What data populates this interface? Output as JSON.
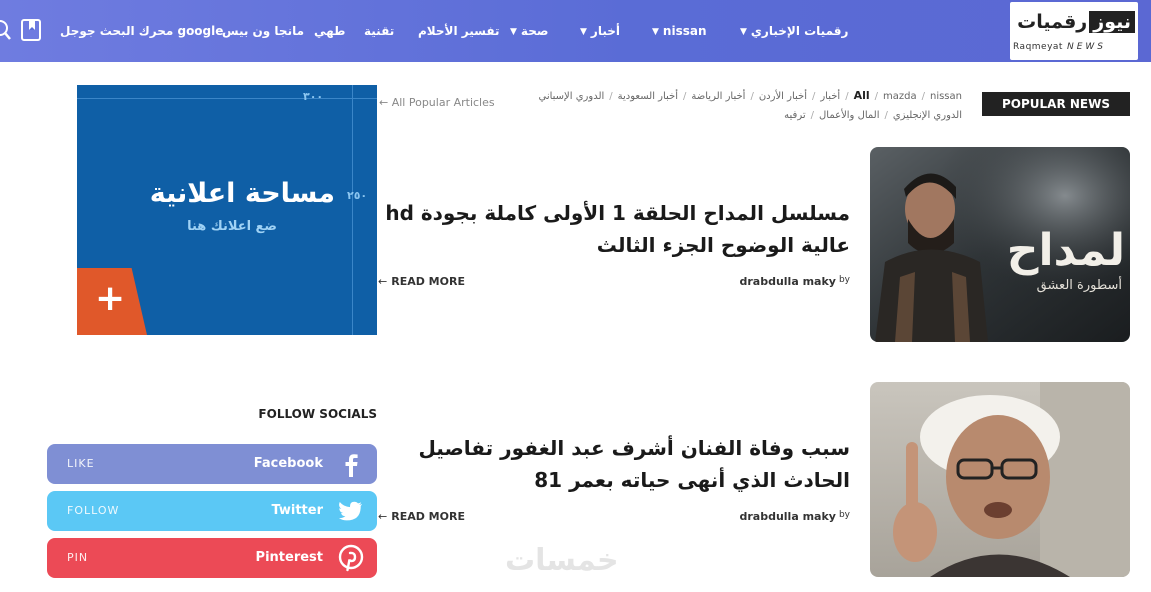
{
  "nav": {
    "logo": {
      "word_dark": "نيوز",
      "word_light": "رقميات",
      "latin": "Raqmeyat",
      "news": "NEWS"
    },
    "items": [
      {
        "label": "رقميات الإخباري",
        "has_caret": true
      },
      {
        "label": "nissan",
        "has_caret": true
      },
      {
        "label": "أخبار",
        "has_caret": true
      },
      {
        "label": "صحة",
        "has_caret": true
      },
      {
        "label": "تفسير الأحلام",
        "has_caret": false
      },
      {
        "label": "تقنية",
        "has_caret": false
      },
      {
        "label": "طهي",
        "has_caret": false
      },
      {
        "label": "مانجا ون بيس",
        "has_caret": false
      },
      {
        "label": "محرك البحث جوجل google",
        "has_caret": false
      }
    ]
  },
  "popular_news": {
    "label": "POPULAR NEWS"
  },
  "tags": {
    "row1": [
      "All",
      "mazda",
      "nissan",
      "أخبار",
      "أخبار الأردن",
      "أخبار الرياضة",
      "أخبار السعودية",
      "الدوري الإسباني"
    ],
    "row2": [
      "الدوري الإنجليزي",
      "المال والأعمال",
      "ترفيه"
    ]
  },
  "ad": {
    "title": "مساحة اعلانية",
    "subtitle": "ضع اعلانك هنا",
    "dim_width": "٣٠٠",
    "dim_height": "٢٥٠",
    "plus": "+"
  },
  "all_popular": "All Popular Articles",
  "articles": [
    {
      "title": "مسلسل المداح الحلقة 1 الأولى كاملة بجودة hd عالية الوضوح الجزء الثالث",
      "author": "drabdulla maky",
      "by": "by",
      "read_more": "READ MORE",
      "img_text_big": "لمداح",
      "img_text_small": "أسطورة العشق"
    },
    {
      "title": "سبب وفاة الفنان أشرف عبد الغفور تفاصيل الحادث الذي أنهى حياته بعمر 81",
      "author": "drabdulla maky",
      "by": "by",
      "read_more": "READ MORE"
    }
  ],
  "follow": {
    "title": "FOLLOW SOCIALS",
    "items": [
      {
        "action": "LIKE",
        "name": "Facebook",
        "color": "#7f8fd4",
        "icon": "facebook-icon"
      },
      {
        "action": "FOLLOW",
        "name": "Twitter",
        "color": "#5bc8f5",
        "icon": "twitter-icon"
      },
      {
        "action": "PIN",
        "name": "Pinterest",
        "color": "#ec4a56",
        "icon": "pinterest-icon"
      }
    ]
  },
  "watermark": "خمسات"
}
